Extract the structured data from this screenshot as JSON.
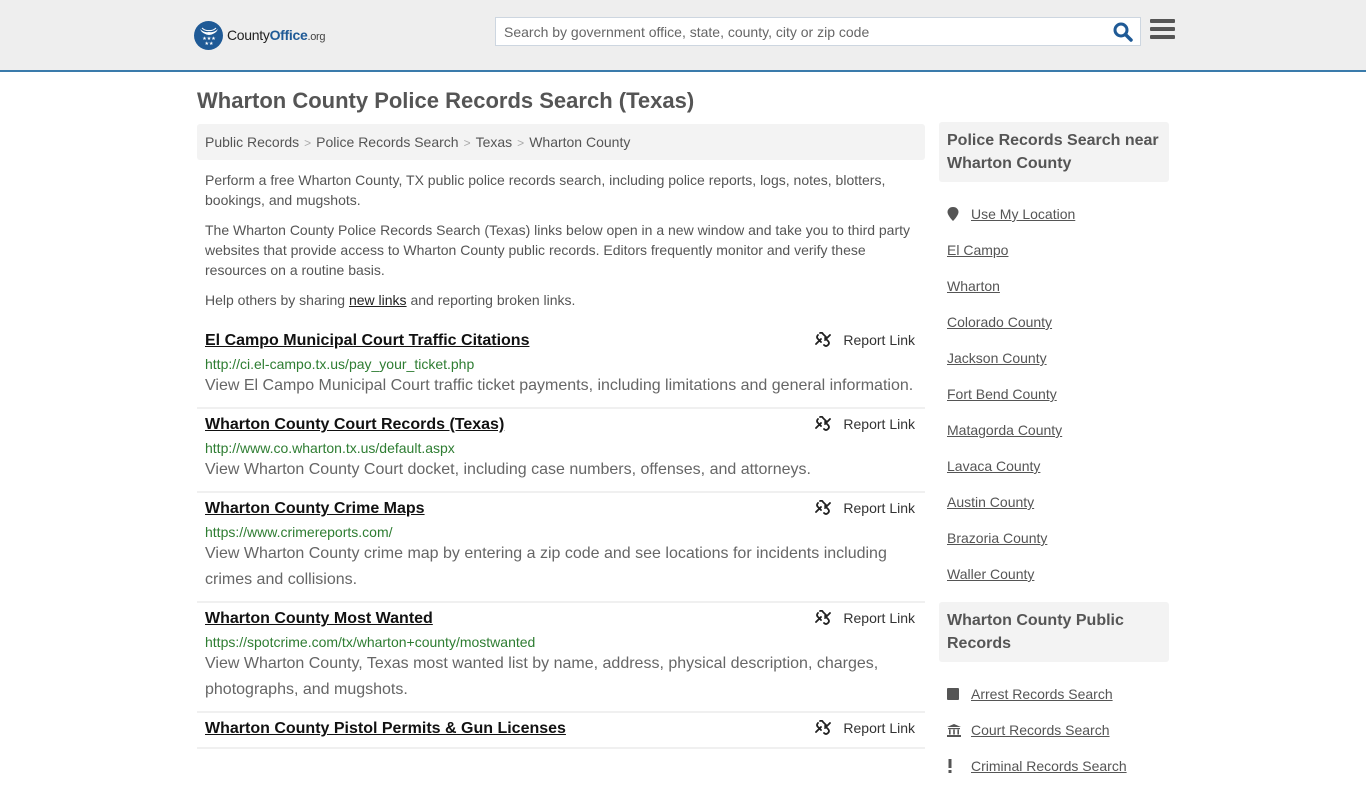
{
  "header": {
    "logo": {
      "name": "County",
      "name_bold": "Office",
      "tld": ".org"
    },
    "search": {
      "placeholder": "Search by government office, state, county, city or zip code",
      "value": ""
    },
    "brand_color": "#1f5a96",
    "border_color": "#3a7bab"
  },
  "page": {
    "title": "Wharton County Police Records Search (Texas)"
  },
  "breadcrumb": [
    "Public Records",
    "Police Records Search",
    "Texas",
    "Wharton County"
  ],
  "intro": {
    "p1": "Perform a free Wharton County, TX public police records search, including police reports, logs, notes, blotters, bookings, and mugshots.",
    "p2": "The Wharton County Police Records Search (Texas) links below open in a new window and take you to third party websites that provide access to Wharton County public records. Editors frequently monitor and verify these resources on a routine basis.",
    "p3_before": "Help others by sharing ",
    "p3_link": "new links",
    "p3_after": " and reporting broken links."
  },
  "results": [
    {
      "title": "El Campo Municipal Court Traffic Citations",
      "url": "http://ci.el-campo.tx.us/pay_your_ticket.php",
      "description": "View El Campo Municipal Court traffic ticket payments, including limitations and general information.",
      "report_label": "Report Link"
    },
    {
      "title": "Wharton County Court Records (Texas)",
      "url": "http://www.co.wharton.tx.us/default.aspx",
      "description": "View Wharton County Court docket, including case numbers, offenses, and attorneys.",
      "report_label": "Report Link"
    },
    {
      "title": "Wharton County Crime Maps",
      "url": "https://www.crimereports.com/",
      "description": "View Wharton County crime map by entering a zip code and see locations for incidents including crimes and collisions.",
      "report_label": "Report Link"
    },
    {
      "title": "Wharton County Most Wanted",
      "url": "https://spotcrime.com/tx/wharton+county/mostwanted",
      "description": "View Wharton County, Texas most wanted list by name, address, physical description, charges, photographs, and mugshots.",
      "report_label": "Report Link"
    },
    {
      "title": "Wharton County Pistol Permits & Gun Licenses",
      "url": "",
      "description": "",
      "report_label": "Report Link"
    }
  ],
  "sidebar": {
    "nearby": {
      "heading": "Police Records Search near Wharton County",
      "use_location": "Use My Location",
      "items": [
        "El Campo",
        "Wharton",
        "Colorado County",
        "Jackson County",
        "Fort Bend County",
        "Matagorda County",
        "Lavaca County",
        "Austin County",
        "Brazoria County",
        "Waller County"
      ]
    },
    "public_records": {
      "heading": "Wharton County Public Records",
      "items": [
        {
          "label": "Arrest Records Search",
          "icon": "square-icon"
        },
        {
          "label": "Court Records Search",
          "icon": "courthouse-icon"
        },
        {
          "label": "Criminal Records Search",
          "icon": "exclamation-icon"
        }
      ]
    }
  }
}
